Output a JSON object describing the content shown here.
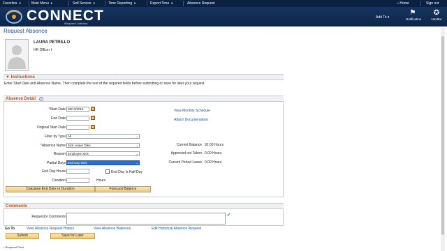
{
  "topnav": {
    "items": [
      "Favorites",
      "Main Menu",
      "Self Service",
      "Time Reporting",
      "Report Time"
    ],
    "current": "Absence Request",
    "home": "Home",
    "signout": "Sign out"
  },
  "header": {
    "logo_text": "CONNECT",
    "logo_sub": "Maryland Judiciary",
    "add_to": "Add To",
    "notification": "Notification",
    "navbar": "NavBar"
  },
  "page": {
    "title": "Request Absence",
    "employee_name": "LAURA PETRILLO",
    "employee_role": "HR Officer I"
  },
  "instructions": {
    "heading": "Instructions",
    "text": "Enter Start Date and Absence Name. Then complete the rest of the required fields before submitting or save for later your request."
  },
  "absence_detail": {
    "heading": "Absence Detail",
    "start_date_label": "Start Date",
    "start_date": "09/13/2015",
    "end_date_label": "End Date",
    "end_date": "",
    "original_start_label": "Original Start Date",
    "original_start": "",
    "filter_label": "Filter by Type",
    "filter_value": "All",
    "absence_name_label": "Absence Name",
    "absence_name": "Sick Leave Take",
    "reason_label": "Reason",
    "reason": "Employee Sick",
    "partial_days_label": "Partial Days",
    "partial_days": "End Day Only",
    "end_day_hours_label": "End Day Hours",
    "end_day_hours": "",
    "half_day_label": "End Day Is Half Day",
    "duration_label": "Duration",
    "duration": "",
    "hours_unit": "Hours",
    "calc_button": "Calculate End Date or Duration",
    "forecast_button": "Forecast Balance",
    "view_schedule": "View Monthly Schedule",
    "attach_doc": "Attach Documentation",
    "current_balance_label": "Current Balance",
    "current_balance": "92.00 Hours",
    "approved_not_taken_label": "Approved not Taken",
    "approved_not_taken": "0.00 Hours",
    "current_period_label": "Current Period Leave",
    "current_period": "0.00 Hours"
  },
  "comments": {
    "heading": "Comments",
    "requestor_label": "Requestor Comments",
    "requestor_value": ""
  },
  "footer": {
    "goto_label": "Go To",
    "links": [
      "View Absence Request History",
      "View Absence Balances",
      "Edit Historical Absence Request"
    ],
    "submit": "Submit",
    "save_later": "Save for Later",
    "required_note": "* Required Field"
  }
}
